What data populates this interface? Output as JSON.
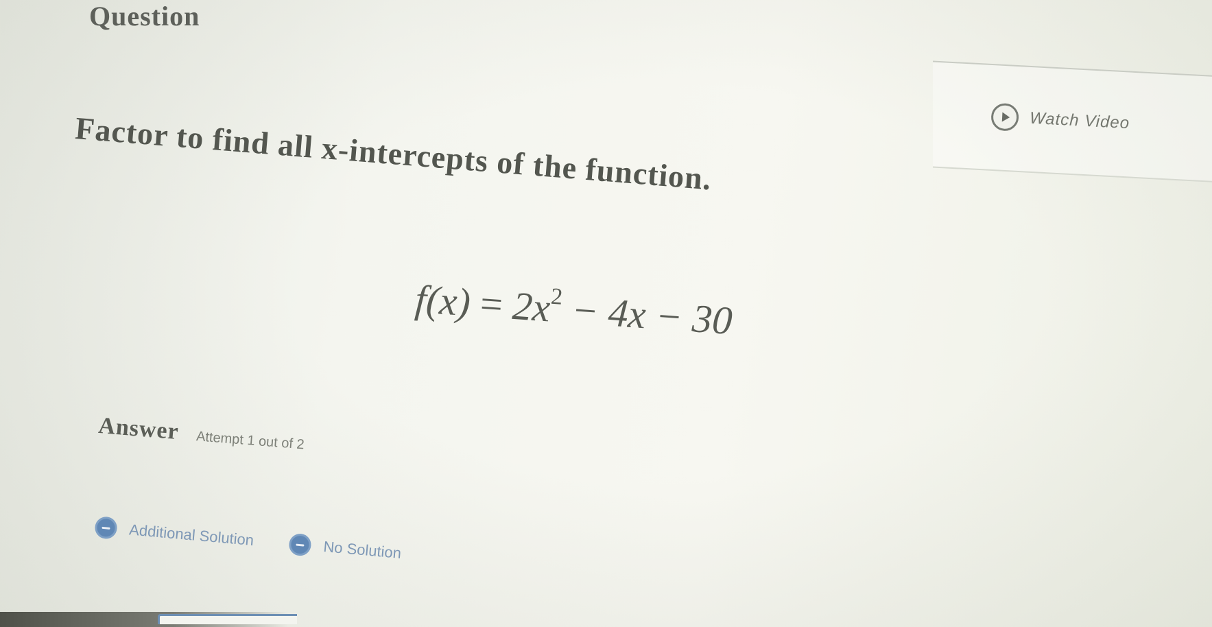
{
  "header": {
    "title": "Question"
  },
  "watch_video": {
    "label": "Watch Video",
    "icon": "play-circle-icon"
  },
  "question": {
    "prompt": "Factor to find all x-intercepts of the function.",
    "equation": {
      "lhs": "f(x)",
      "equals": "=",
      "term1": "2x",
      "exponent": "2",
      "rest": "− 4x − 30"
    }
  },
  "answer": {
    "title": "Answer",
    "attempt": "Attempt 1 out of 2"
  },
  "solutions": {
    "additional_label": "Additional Solution",
    "no_label": "No Solution",
    "icon_color": "#5f87b5"
  }
}
